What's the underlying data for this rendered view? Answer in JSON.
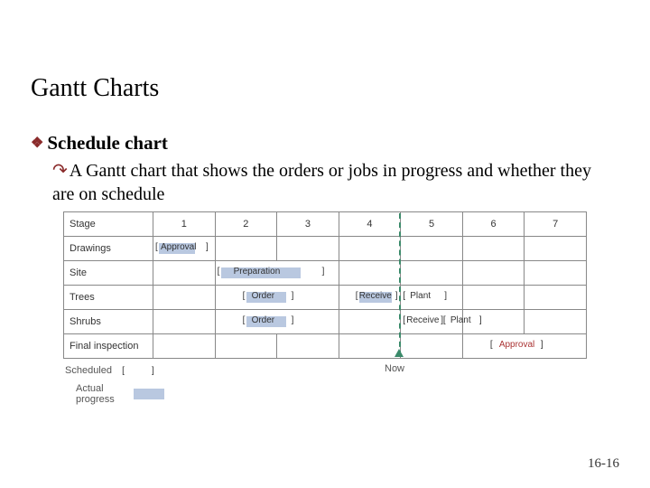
{
  "title": "Gantt Charts",
  "heading": "Schedule chart",
  "desc": "A Gantt chart that shows the orders or jobs in progress and whether they are on schedule",
  "stage_label": "Stage",
  "cols": [
    "1",
    "2",
    "3",
    "4",
    "5",
    "6",
    "7"
  ],
  "rows": [
    "Drawings",
    "Site",
    "Trees",
    "Shrubs",
    "Final inspection"
  ],
  "labels": {
    "approval": "Approval",
    "preparation": "Preparation",
    "order": "Order",
    "receive": "Receive",
    "plant": "Plant"
  },
  "legend": {
    "scheduled": "Scheduled",
    "actual": "Actual progress",
    "now": "Now"
  },
  "brackets": {
    "l": "[",
    "r": "]"
  },
  "pagenum": "16-16",
  "chart_data": {
    "type": "gantt",
    "time_axis": {
      "start": 1,
      "end": 7,
      "now": 5
    },
    "tasks": [
      {
        "name": "Drawings",
        "scheduled": [
          {
            "label": "Approval",
            "start": 1,
            "end": 1.9
          }
        ],
        "actual": [
          {
            "start": 1,
            "end": 1.6
          }
        ]
      },
      {
        "name": "Site",
        "scheduled": [
          {
            "label": "Preparation",
            "start": 2,
            "end": 3.8
          }
        ],
        "actual": [
          {
            "start": 2,
            "end": 3.4
          }
        ]
      },
      {
        "name": "Trees",
        "scheduled": [
          {
            "label": "Order",
            "start": 2.5,
            "end": 3.3
          },
          {
            "label": "Receive",
            "start": 4.3,
            "end": 5.0
          },
          {
            "label": "Plant",
            "start": 5.0,
            "end": 5.8
          }
        ],
        "actual": [
          {
            "start": 2.5,
            "end": 3.2
          },
          {
            "start": 4.3,
            "end": 4.9
          }
        ]
      },
      {
        "name": "Shrubs",
        "scheduled": [
          {
            "label": "Order",
            "start": 2.5,
            "end": 3.3
          },
          {
            "label": "Receive",
            "start": 5.0,
            "end": 5.6
          },
          {
            "label": "Plant",
            "start": 5.6,
            "end": 6.3
          }
        ],
        "actual": [
          {
            "start": 2.5,
            "end": 3.2
          }
        ]
      },
      {
        "name": "Final inspection",
        "scheduled": [
          {
            "label": "Approval",
            "start": 6.5,
            "end": 7.3
          }
        ],
        "actual": []
      }
    ]
  }
}
